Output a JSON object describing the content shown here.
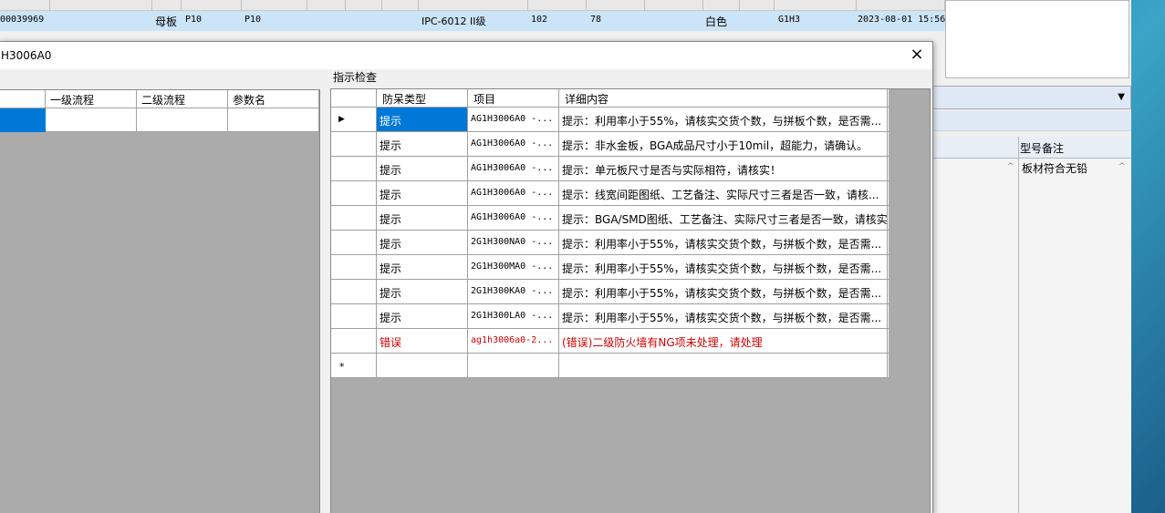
{
  "background_app": {
    "selected_row": {
      "id": "00039969",
      "board_type": "母板",
      "col_a": "P10",
      "col_b": "P10",
      "spec": "IPC-6012 II级",
      "num_a": "102",
      "num_b": "78",
      "color": "白色",
      "code": "G1H3",
      "datetime": "2023-08-01 15:56"
    },
    "right_panel": {
      "column_header": "型号备注",
      "cell_value": "板材符合无铅"
    }
  },
  "dialog": {
    "title": "H3006A0",
    "close_symbol": "×",
    "left_grid": {
      "columns": [
        "一级流程",
        "二级流程",
        "参数名"
      ]
    },
    "group_label": "指示检查",
    "grid": {
      "columns": [
        "防呆类型",
        "项目",
        "详细内容"
      ],
      "rows": [
        {
          "type": "提示",
          "item": "AG1H3006A0 -...",
          "detail": "提示：利用率小于55%，请核实交货个数，与拼板个数，是否需..."
        },
        {
          "type": "提示",
          "item": "AG1H3006A0 -...",
          "detail": "提示：非水金板，BGA成品尺寸小于10mil，超能力，请确认。"
        },
        {
          "type": "提示",
          "item": "AG1H3006A0 -...",
          "detail": "提示：单元板尺寸是否与实际相符，请核实！"
        },
        {
          "type": "提示",
          "item": "AG1H3006A0 -...",
          "detail": "提示：线宽间距图纸、工艺备注、实际尺寸三者是否一致，请核..."
        },
        {
          "type": "提示",
          "item": "AG1H3006A0 -...",
          "detail": "提示：BGA/SMD图纸、工艺备注、实际尺寸三者是否一致，请核实！"
        },
        {
          "type": "提示",
          "item": "2G1H300NA0 -...",
          "detail": "提示：利用率小于55%，请核实交货个数，与拼板个数，是否需..."
        },
        {
          "type": "提示",
          "item": "2G1H300MA0 -...",
          "detail": "提示：利用率小于55%，请核实交货个数，与拼板个数，是否需..."
        },
        {
          "type": "提示",
          "item": "2G1H300KA0 -...",
          "detail": "提示：利用率小于55%，请核实交货个数，与拼板个数，是否需..."
        },
        {
          "type": "提示",
          "item": "2G1H300LA0 -...",
          "detail": "提示：利用率小于55%，请核实交货个数，与拼板个数，是否需..."
        },
        {
          "type": "错误",
          "item": "ag1h3006a0-2...",
          "detail": "(错误)二级防火墙有NG项未处理，请处理"
        }
      ],
      "current_row_marker": "▶",
      "new_row_marker": "*"
    }
  },
  "colors": {
    "selection": "#0078d7",
    "error_text": "#d00000",
    "grid_background": "#ababab"
  }
}
